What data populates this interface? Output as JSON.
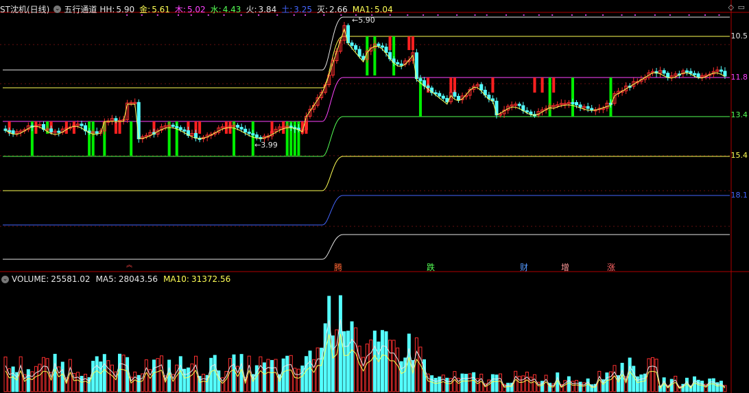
{
  "header": {
    "stock_name": "ST沈机(日线)",
    "indicator_name": "五行通道",
    "values": [
      {
        "label": "HH:",
        "value": "5.90",
        "color": "#e6e6e6"
      },
      {
        "label": "金:",
        "value": "5.61",
        "color": "#ffff55"
      },
      {
        "label": "木:",
        "value": "5.02",
        "color": "#ff44ff"
      },
      {
        "label": "水:",
        "value": "4.43",
        "color": "#55ff55"
      },
      {
        "label": "火:",
        "value": "3.84",
        "color": "#e6e6e6"
      },
      {
        "label": "土:",
        "value": "3.25",
        "color": "#4466ff"
      },
      {
        "label": "灭:",
        "value": "2.66",
        "color": "#e6e6e6"
      },
      {
        "label": "MA1:",
        "value": "5.04",
        "color": "#ffff55"
      }
    ]
  },
  "volume_header": {
    "volume_label": "VOLUME:",
    "volume_value": "25581.02",
    "ma5_label": "MA5:",
    "ma5_value": "28043.56",
    "ma10_label": "MA10:",
    "ma10_value": "31372.56"
  },
  "right_axis_labels": [
    {
      "text": "10.5",
      "color": "#e6e6e6"
    },
    {
      "text": "11.8",
      "color": "#ff44ff"
    },
    {
      "text": "13.4",
      "color": "#55ff55"
    },
    {
      "text": "15.4",
      "color": "#ffff55"
    },
    {
      "text": "18.1",
      "color": "#4466ff"
    }
  ],
  "price_annotations": {
    "high": "5.90",
    "low": "3.99"
  },
  "signals": [
    {
      "text": "腾",
      "color": "#ff6633"
    },
    {
      "text": "跌",
      "color": "#55ff55"
    },
    {
      "text": "财",
      "color": "#5599ff"
    },
    {
      "text": "增",
      "color": "#ff9999"
    },
    {
      "text": "涨",
      "color": "#ff6666"
    }
  ],
  "icons": {
    "dropdown": "chevron-down-icon",
    "menu": "diamond-icon",
    "window": "window-icon",
    "up_marker": "double-chevron-up-icon"
  },
  "colors": {
    "up": "#ff3030",
    "down": "#00ff00",
    "volume_up": "#ff3030",
    "volume_down": "#55ffff",
    "ma5": "#e6e6e6",
    "ma10": "#ffff55"
  }
}
